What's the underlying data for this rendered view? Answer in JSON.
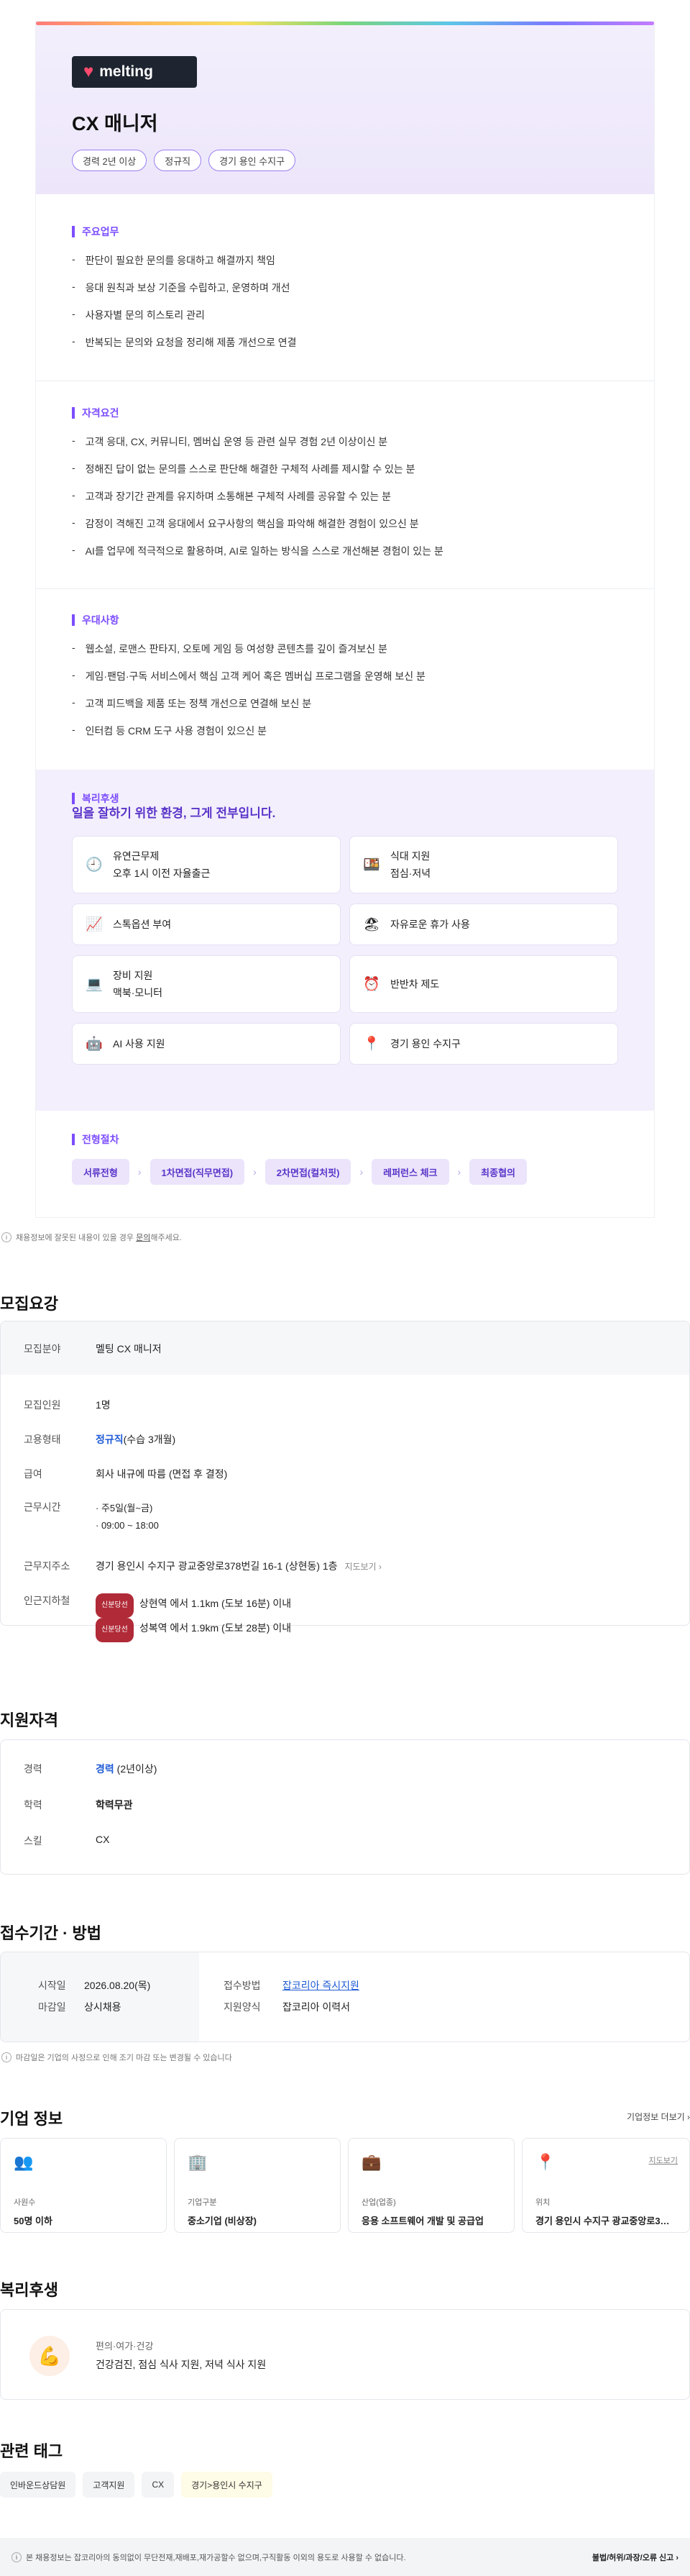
{
  "brand": {
    "logo_text": "melting"
  },
  "job": {
    "title": "CX 매니저",
    "chips": [
      "경력 2년 이상",
      "정규직",
      "경기 용인 수지구"
    ]
  },
  "duties": {
    "heading": "주요업무",
    "items": [
      "판단이 필요한 문의를 응대하고 해결까지 책임",
      "응대 원칙과 보상 기준을 수립하고, 운영하며 개선",
      "사용자별 문의 히스토리 관리",
      "반복되는 문의와 요청을 정리해 제품 개선으로 연결"
    ]
  },
  "quals": {
    "heading": "자격요건",
    "items": [
      "고객 응대, CX, 커뮤니티, 멤버십 운영 등 관련 실무 경험 2년 이상이신 분",
      "정해진 답이 없는 문의를 스스로 판단해 해결한 구체적 사례를 제시할 수 있는 분",
      "고객과 장기간 관계를 유지하며 소통해본 구체적 사례를 공유할 수 있는 분",
      "감정이 격해진 고객 응대에서 요구사항의 핵심을 파악해 해결한 경험이 있으신 분",
      "AI를 업무에 적극적으로 활용하며, AI로 일하는 방식을 스스로 개선해본 경험이 있는 분"
    ]
  },
  "prefs": {
    "heading": "우대사항",
    "items": [
      "웹소설, 로맨스 판타지, 오토메 게임 등 여성향 콘텐츠를 깊이 즐겨보신 분",
      "게임·팬덤·구독 서비스에서 핵심 고객 케어 혹은 멤버십 프로그램을 운영해 보신 분",
      "고객 피드백을 제품 또는 정책 개선으로 연결해 보신 분",
      "인터컴 등 CRM 도구 사용 경험이 있으신 분"
    ]
  },
  "benefits": {
    "heading": "복리후생",
    "subheading": "일을 잘하기 위한 환경, 그게 전부입니다.",
    "items": [
      {
        "icon": "clock-icon",
        "glyph": "🕘",
        "line1": "유연근무제",
        "line2": "오후 1시 이전 자율출근"
      },
      {
        "icon": "meal-icon",
        "glyph": "🍱",
        "line1": "식대 지원",
        "line2": "점심·저녁"
      },
      {
        "icon": "chart-icon",
        "glyph": "📈",
        "line1": "스톡옵션 부여",
        "line2": ""
      },
      {
        "icon": "beach-icon",
        "glyph": "🏖",
        "line1": "자유로운 휴가 사용",
        "line2": ""
      },
      {
        "icon": "laptop-icon",
        "glyph": "💻",
        "line1": "장비 지원",
        "line2": "맥북·모니터"
      },
      {
        "icon": "alarm-icon",
        "glyph": "⏰",
        "line1": "반반차 제도",
        "line2": ""
      },
      {
        "icon": "robot-icon",
        "glyph": "🤖",
        "line1": "AI 사용 지원",
        "line2": ""
      },
      {
        "icon": "pin-icon",
        "glyph": "📍",
        "line1": "경기 용인 수지구",
        "line2": ""
      }
    ]
  },
  "process": {
    "heading": "전형절차",
    "steps": [
      "서류전형",
      "1차면접(직무면접)",
      "2차면접(컬처핏)",
      "레퍼런스 체크",
      "최종협의"
    ]
  },
  "notice": {
    "text_before": "채용정보에 잘못된 내용이 있을 경우 ",
    "link": "문의",
    "text_after": "해주세요."
  },
  "recruit": {
    "heading": "모집요강",
    "field_label": "모집분야",
    "field_value": "멜팅 CX 매니저",
    "count_label": "모집인원",
    "count_value": "1명",
    "type_label": "고용형태",
    "type_value": "정규직",
    "type_extra": "(수습 3개월)",
    "salary_label": "급여",
    "salary_value": "회사 내규에 따름 (면접 후 결정)",
    "hours_label": "근무시간",
    "hours_1": "주5일(월~금)",
    "hours_2": "09:00 ~ 18:00",
    "addr_label": "근무지주소",
    "addr_value": "경기 용인시 수지구 광교중앙로378번길 16-1 (상현동) 1층",
    "map_link": "지도보기 ›",
    "subway_label": "인근지하철",
    "subway_tag": "신분당선",
    "subway_1": "상현역 에서 1.1km (도보 16분) 이내",
    "subway_2": "성복역 에서 1.9km (도보 28분) 이내"
  },
  "qualify": {
    "heading": "지원자격",
    "exp_label": "경력",
    "exp_value": "경력",
    "exp_extra": "(2년이상)",
    "edu_label": "학력",
    "edu_value": "학력무관",
    "skill_label": "스킬",
    "skill_value": "CX"
  },
  "period": {
    "heading": "접수기간 · 방법",
    "start_label": "시작일",
    "start_value": "2026.08.20(목)",
    "end_label": "마감일",
    "end_value": "상시채용",
    "method_label": "접수방법",
    "method_value": "잡코리아 즉시지원",
    "form_label": "지원양식",
    "form_value": "잡코리아 이력서",
    "note": "마감일은 기업의 사정으로 인해 조기 마감 또는 변경될 수 있습니다"
  },
  "company": {
    "heading": "기업 정보",
    "more": "기업정보 더보기 ›",
    "items": [
      {
        "icon": "people-icon",
        "glyph": "👥",
        "label": "사원수",
        "value": "50명 이하"
      },
      {
        "icon": "building-icon",
        "glyph": "🏢",
        "label": "기업구분",
        "value": "중소기업 (비상장)"
      },
      {
        "icon": "briefcase-icon",
        "glyph": "💼",
        "label": "산업(업종)",
        "value": "응용 소프트웨어 개발 및 공급업"
      },
      {
        "icon": "location-icon",
        "glyph": "📍",
        "label": "위치",
        "value": "경기 용인시 수지구 광교중앙로3…",
        "extra": "지도보기"
      }
    ]
  },
  "welfare": {
    "heading": "복리후생",
    "category": "편의·여가·건강",
    "value": "건강검진, 점심 식사 지원, 저녁 식사 지원"
  },
  "tags": {
    "heading": "관련 태그",
    "items": [
      "인바운드상담원",
      "고객지원",
      "CX",
      "경기>용인시 수지구"
    ]
  },
  "footer": {
    "text": "본 채용정보는 잡코리아의 동의없이 무단전재,재배포,재가공할수 없으며,구직활동 이외의 용도로 사용할 수 없습니다.",
    "report": "불법/허위/과장/오류 신고 ›"
  }
}
